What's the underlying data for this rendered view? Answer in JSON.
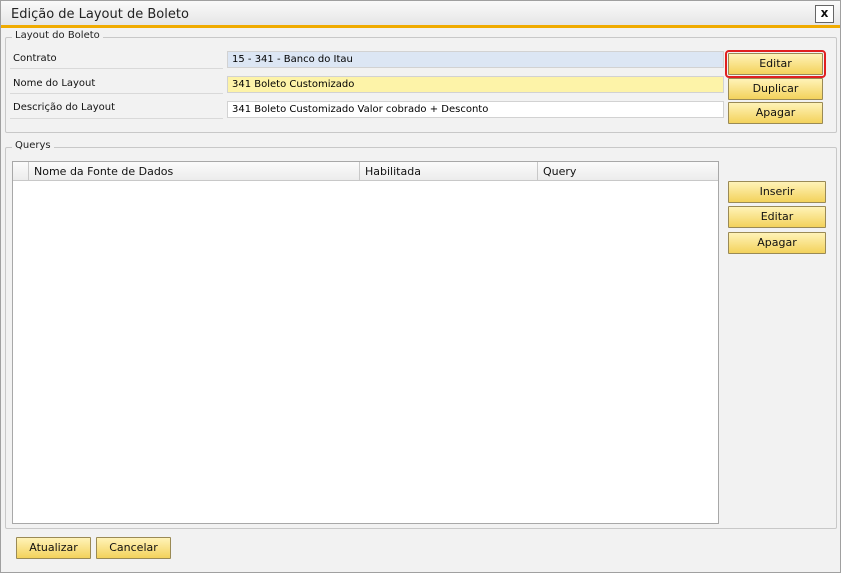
{
  "window": {
    "title": "Edição de Layout de Boleto",
    "close_label": "x"
  },
  "layout_group": {
    "legend": "Layout do Boleto",
    "fields": [
      {
        "label": "Contrato",
        "value": "15 - 341 - Banco do Itau"
      },
      {
        "label": "Nome do Layout",
        "value": "341  Boleto Customizado"
      },
      {
        "label": "Descrição do Layout",
        "value": "341  Boleto  Customizado Valor cobrado + Desconto"
      }
    ],
    "buttons": {
      "edit": "Editar",
      "duplicate": "Duplicar",
      "delete": "Apagar"
    }
  },
  "querys_group": {
    "legend": "Querys",
    "columns": [
      "Nome da Fonte de Dados",
      "Habilitada",
      "Query"
    ],
    "rows": [],
    "buttons": {
      "insert": "Inserir",
      "edit": "Editar",
      "delete": "Apagar"
    }
  },
  "footer": {
    "update": "Atualizar",
    "cancel": "Cancelar"
  },
  "colors": {
    "accent": "#f0ab00",
    "button_top": "#fff3b8",
    "button_bottom": "#f3d25c",
    "focus_outline": "#e02020"
  }
}
